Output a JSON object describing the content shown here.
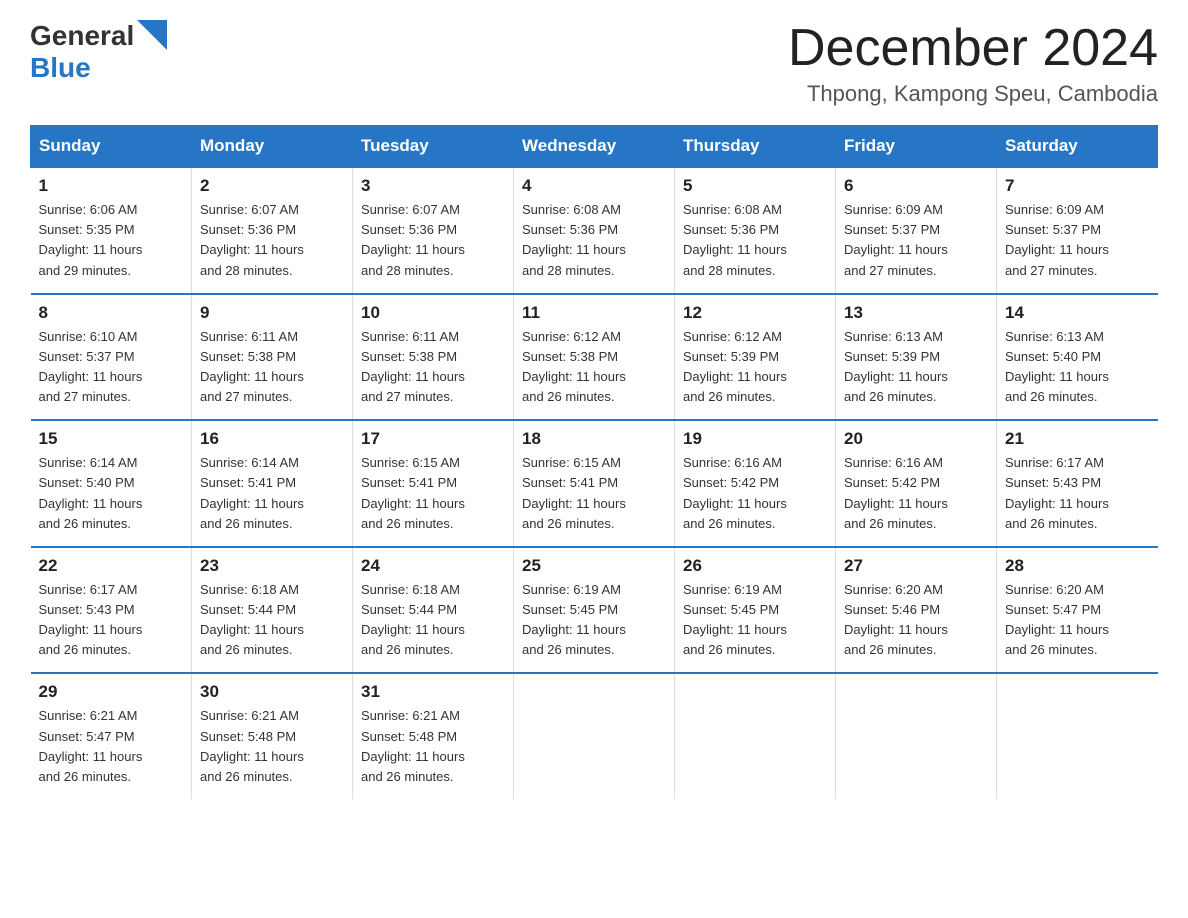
{
  "header": {
    "logo": {
      "general": "General",
      "blue": "Blue",
      "triangle_color": "#2776c6"
    },
    "month": "December 2024",
    "location": "Thpong, Kampong Speu, Cambodia"
  },
  "weekdays": [
    "Sunday",
    "Monday",
    "Tuesday",
    "Wednesday",
    "Thursday",
    "Friday",
    "Saturday"
  ],
  "weeks": [
    [
      {
        "day": "1",
        "sunrise": "6:06 AM",
        "sunset": "5:35 PM",
        "daylight": "11 hours and 29 minutes."
      },
      {
        "day": "2",
        "sunrise": "6:07 AM",
        "sunset": "5:36 PM",
        "daylight": "11 hours and 28 minutes."
      },
      {
        "day": "3",
        "sunrise": "6:07 AM",
        "sunset": "5:36 PM",
        "daylight": "11 hours and 28 minutes."
      },
      {
        "day": "4",
        "sunrise": "6:08 AM",
        "sunset": "5:36 PM",
        "daylight": "11 hours and 28 minutes."
      },
      {
        "day": "5",
        "sunrise": "6:08 AM",
        "sunset": "5:36 PM",
        "daylight": "11 hours and 28 minutes."
      },
      {
        "day": "6",
        "sunrise": "6:09 AM",
        "sunset": "5:37 PM",
        "daylight": "11 hours and 27 minutes."
      },
      {
        "day": "7",
        "sunrise": "6:09 AM",
        "sunset": "5:37 PM",
        "daylight": "11 hours and 27 minutes."
      }
    ],
    [
      {
        "day": "8",
        "sunrise": "6:10 AM",
        "sunset": "5:37 PM",
        "daylight": "11 hours and 27 minutes."
      },
      {
        "day": "9",
        "sunrise": "6:11 AM",
        "sunset": "5:38 PM",
        "daylight": "11 hours and 27 minutes."
      },
      {
        "day": "10",
        "sunrise": "6:11 AM",
        "sunset": "5:38 PM",
        "daylight": "11 hours and 27 minutes."
      },
      {
        "day": "11",
        "sunrise": "6:12 AM",
        "sunset": "5:38 PM",
        "daylight": "11 hours and 26 minutes."
      },
      {
        "day": "12",
        "sunrise": "6:12 AM",
        "sunset": "5:39 PM",
        "daylight": "11 hours and 26 minutes."
      },
      {
        "day": "13",
        "sunrise": "6:13 AM",
        "sunset": "5:39 PM",
        "daylight": "11 hours and 26 minutes."
      },
      {
        "day": "14",
        "sunrise": "6:13 AM",
        "sunset": "5:40 PM",
        "daylight": "11 hours and 26 minutes."
      }
    ],
    [
      {
        "day": "15",
        "sunrise": "6:14 AM",
        "sunset": "5:40 PM",
        "daylight": "11 hours and 26 minutes."
      },
      {
        "day": "16",
        "sunrise": "6:14 AM",
        "sunset": "5:41 PM",
        "daylight": "11 hours and 26 minutes."
      },
      {
        "day": "17",
        "sunrise": "6:15 AM",
        "sunset": "5:41 PM",
        "daylight": "11 hours and 26 minutes."
      },
      {
        "day": "18",
        "sunrise": "6:15 AM",
        "sunset": "5:41 PM",
        "daylight": "11 hours and 26 minutes."
      },
      {
        "day": "19",
        "sunrise": "6:16 AM",
        "sunset": "5:42 PM",
        "daylight": "11 hours and 26 minutes."
      },
      {
        "day": "20",
        "sunrise": "6:16 AM",
        "sunset": "5:42 PM",
        "daylight": "11 hours and 26 minutes."
      },
      {
        "day": "21",
        "sunrise": "6:17 AM",
        "sunset": "5:43 PM",
        "daylight": "11 hours and 26 minutes."
      }
    ],
    [
      {
        "day": "22",
        "sunrise": "6:17 AM",
        "sunset": "5:43 PM",
        "daylight": "11 hours and 26 minutes."
      },
      {
        "day": "23",
        "sunrise": "6:18 AM",
        "sunset": "5:44 PM",
        "daylight": "11 hours and 26 minutes."
      },
      {
        "day": "24",
        "sunrise": "6:18 AM",
        "sunset": "5:44 PM",
        "daylight": "11 hours and 26 minutes."
      },
      {
        "day": "25",
        "sunrise": "6:19 AM",
        "sunset": "5:45 PM",
        "daylight": "11 hours and 26 minutes."
      },
      {
        "day": "26",
        "sunrise": "6:19 AM",
        "sunset": "5:45 PM",
        "daylight": "11 hours and 26 minutes."
      },
      {
        "day": "27",
        "sunrise": "6:20 AM",
        "sunset": "5:46 PM",
        "daylight": "11 hours and 26 minutes."
      },
      {
        "day": "28",
        "sunrise": "6:20 AM",
        "sunset": "5:47 PM",
        "daylight": "11 hours and 26 minutes."
      }
    ],
    [
      {
        "day": "29",
        "sunrise": "6:21 AM",
        "sunset": "5:47 PM",
        "daylight": "11 hours and 26 minutes."
      },
      {
        "day": "30",
        "sunrise": "6:21 AM",
        "sunset": "5:48 PM",
        "daylight": "11 hours and 26 minutes."
      },
      {
        "day": "31",
        "sunrise": "6:21 AM",
        "sunset": "5:48 PM",
        "daylight": "11 hours and 26 minutes."
      },
      null,
      null,
      null,
      null
    ]
  ],
  "labels": {
    "sunrise": "Sunrise:",
    "sunset": "Sunset:",
    "daylight": "Daylight:"
  }
}
